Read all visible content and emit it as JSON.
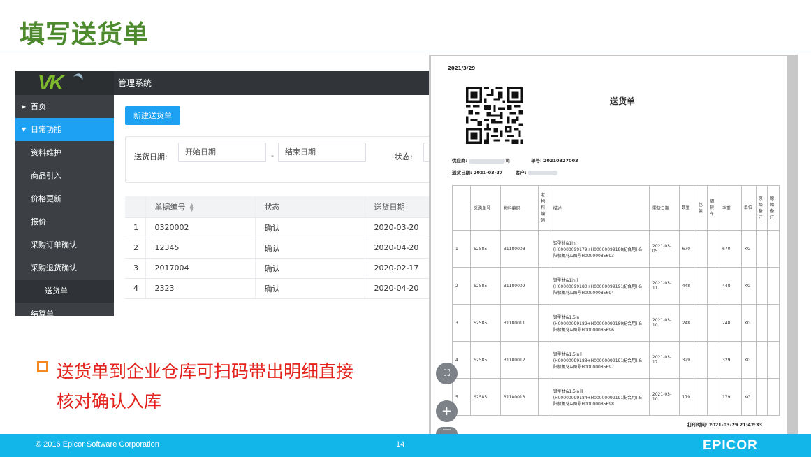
{
  "slide": {
    "title": "填写送货单",
    "bullet": "送货单到企业仓库可扫码带出明细直接核对确认入库"
  },
  "footer": {
    "copyright": "© 2016 Epicor Software Corporation",
    "page_number": "14",
    "brand": "EPICOR"
  },
  "app": {
    "logo": "VK",
    "system_name": "管理系统",
    "sidebar": {
      "items": [
        {
          "label": "首页"
        },
        {
          "label": "日常功能"
        },
        {
          "label": "资料维护"
        },
        {
          "label": "商品引入"
        },
        {
          "label": "价格更新"
        },
        {
          "label": "报价"
        },
        {
          "label": "采购订单确认"
        },
        {
          "label": "采购退货确认"
        },
        {
          "label": "送货单"
        },
        {
          "label": "结算单"
        }
      ]
    },
    "new_button": "新建送货单",
    "filter": {
      "date_label": "送货日期:",
      "start_placeholder": "开始日期",
      "separator": "-",
      "end_placeholder": "结束日期",
      "status_label": "状态:"
    },
    "table": {
      "headers": [
        "单据编号",
        "状态",
        "送货日期"
      ],
      "rows": [
        {
          "idx": "1",
          "no": "0320002",
          "status": "确认",
          "date": "2020-03-20"
        },
        {
          "idx": "2",
          "no": "12345",
          "status": "确认",
          "date": "2020-04-20"
        },
        {
          "idx": "3",
          "no": "2017004",
          "status": "确认",
          "date": "2020-02-17"
        },
        {
          "idx": "4",
          "no": "2323",
          "status": "确认",
          "date": "2020-04-20"
        }
      ]
    }
  },
  "doc": {
    "date": "2021/3/29",
    "title": "送货单",
    "supplier_label": "供应商:",
    "supplier_suffix": "司",
    "doc_no_label": "单号:",
    "doc_no": "20210327003",
    "delivery_date_label": "送货日期:",
    "delivery_date": "2021-03-27",
    "customer_label": "客户:",
    "headers": [
      "",
      "采购单号",
      "物料编码",
      "老物料编码",
      "描述",
      "需货日期",
      "数量",
      "包装",
      "周转车",
      "毛重",
      "单位",
      "原始备注",
      "原始备注"
    ],
    "rows": [
      {
        "idx": "1",
        "po": "S2585",
        "code": "B1180008",
        "desc": "铝型材&1ini (H00000099179+H00000099188配合用) &阳极氧化&图号H00000085693",
        "need_date": "2021-03-05",
        "qty": "670",
        "gross": "670",
        "unit": "KG"
      },
      {
        "idx": "2",
        "po": "S2585",
        "code": "B1180009",
        "desc": "铝型材&1inil (H00000099180+H00000099191配合用) &阳极氧化&图号H00000085694",
        "need_date": "2021-03-11",
        "qty": "448",
        "gross": "448",
        "unit": "KG"
      },
      {
        "idx": "3",
        "po": "S2585",
        "code": "B1180011",
        "desc": "铝型材&1.5inl (H00000099182+H00000099189配合用) &阳极氧化&图号H00000085696",
        "need_date": "2021-03-10",
        "qty": "248",
        "gross": "248",
        "unit": "KG"
      },
      {
        "idx": "4",
        "po": "S2585",
        "code": "B1180012",
        "desc": "铝型材&1.5inll (H00000099183+H00000099191配合用) &阳极氧化&图号H00000085697",
        "need_date": "2021-03-17",
        "qty": "329",
        "gross": "329",
        "unit": "KG"
      },
      {
        "idx": "5",
        "po": "S2585",
        "code": "B1180013",
        "desc": "铝型材&1.5inlll (H00000099184+H00000099191配合用) &阳极氧化&图号H00000085698",
        "need_date": "2021-03-10",
        "qty": "179",
        "gross": "179",
        "unit": "KG"
      }
    ],
    "print_time_label": "打印时间:",
    "print_time": "2021-03-29 21:42:33"
  },
  "viewer": {
    "fit_icon": "fullscreen-icon",
    "zoom_in_icon": "zoom-in-icon",
    "zoom_out_icon": "zoom-out-icon",
    "fit_glyph": "⛶",
    "zoom_in_glyph": "+",
    "zoom_out_glyph": "−"
  },
  "colors": {
    "title_green": "#4e8a2e",
    "bullet_red": "#e3231c",
    "accent_blue": "#1da1f2",
    "footer_blue": "#12b6e9",
    "status_green": "#2cb42c",
    "bullet_orange": "#f5891f"
  }
}
